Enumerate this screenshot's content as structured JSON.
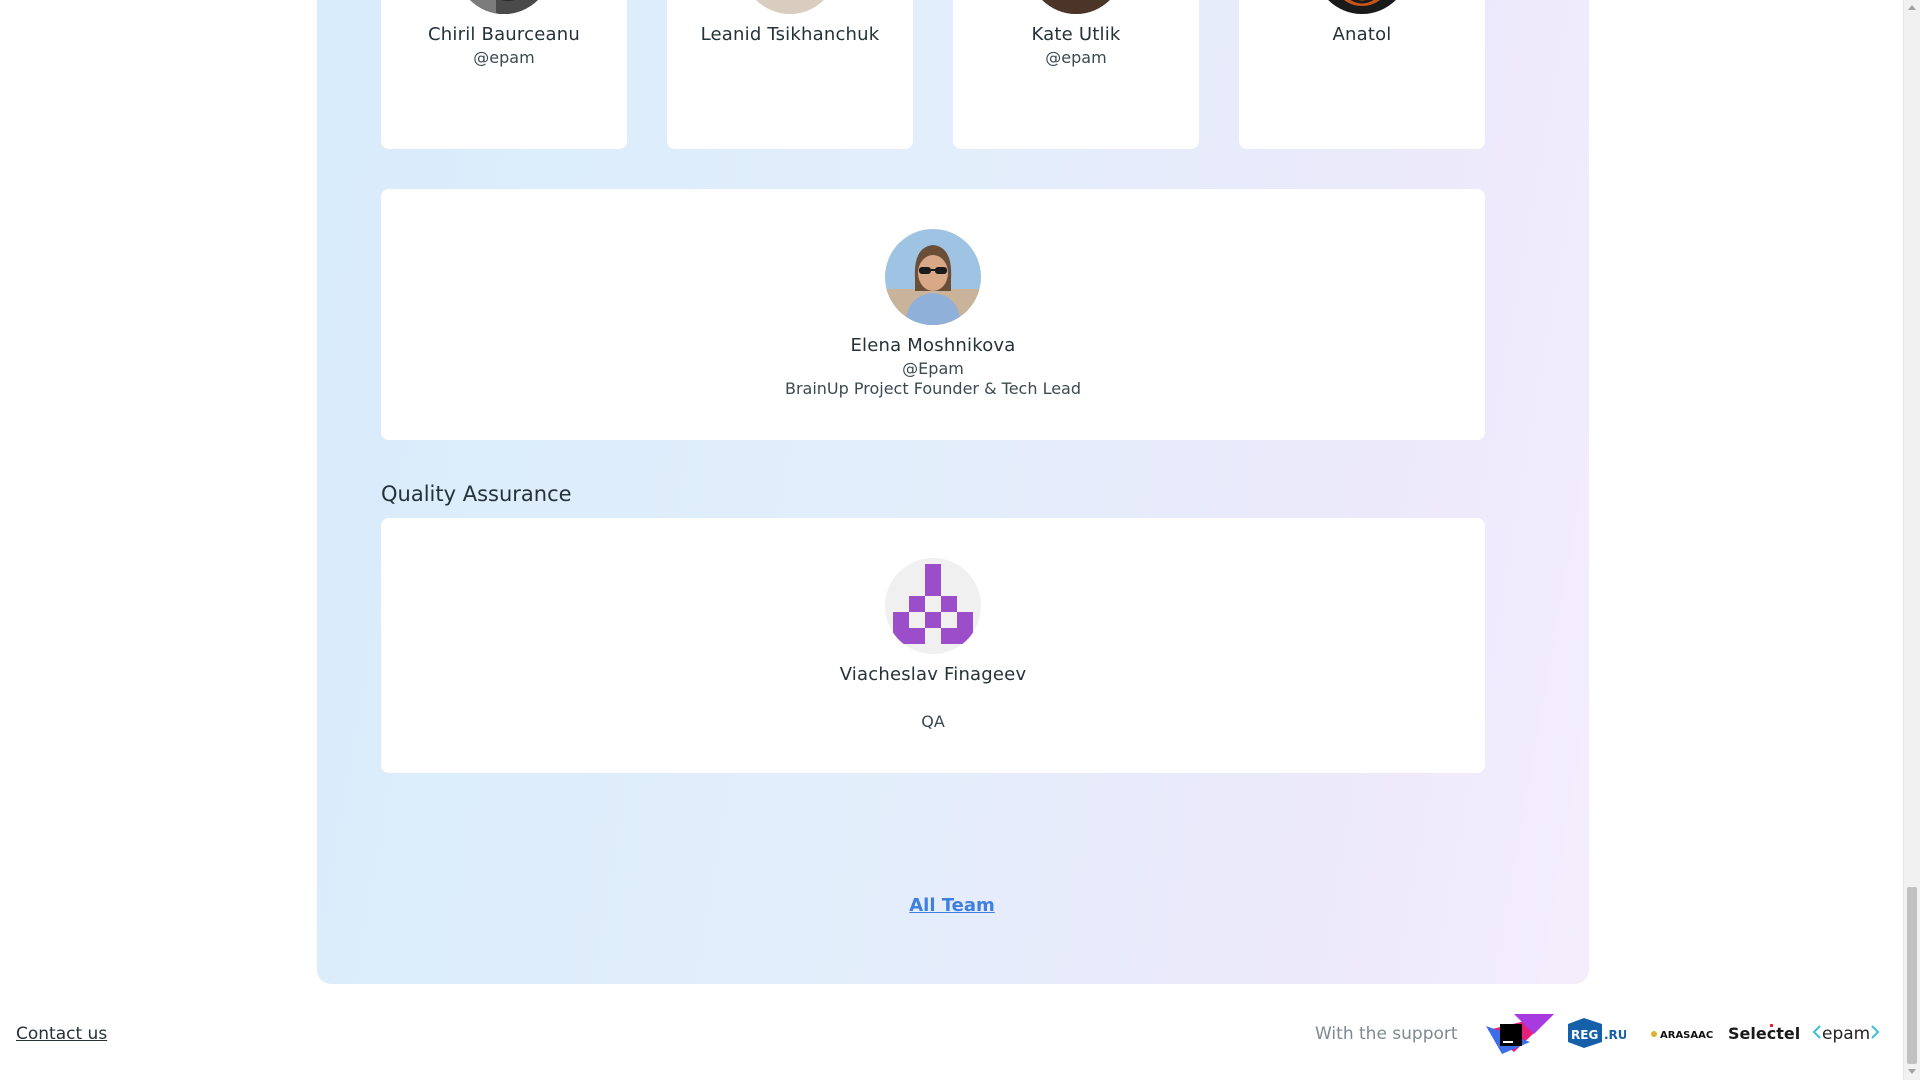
{
  "team_top_row": [
    {
      "name": "Chiril Baurceanu",
      "org": "@epam",
      "avatar_icon": "avatar-bearded-man-icon"
    },
    {
      "name": "Leanid Tsikhanchuk",
      "org": "",
      "avatar_icon": "avatar-opentowork-man-icon"
    },
    {
      "name": "Kate Utlik",
      "org": "@epam",
      "avatar_icon": "avatar-woman-curly-hair-icon"
    },
    {
      "name": "Anatol",
      "org": "",
      "avatar_icon": "avatar-cartoon-glasses-icon"
    }
  ],
  "founder": {
    "name": "Elena Moshnikova",
    "org": "@Epam",
    "role": "BrainUp Project Founder & Tech Lead",
    "avatar_icon": "avatar-woman-sunglasses-icon"
  },
  "qa_section": {
    "title": "Quality Assurance",
    "members": [
      {
        "name": "Viacheslav Finageev",
        "role": "QA",
        "avatar_icon": "avatar-identicon-purple-icon"
      }
    ]
  },
  "all_team_link": "All Team",
  "footer": {
    "contact_label": "Contact us",
    "support_label": "With the support",
    "sponsors": [
      {
        "icon": "jetbrains-logo-icon",
        "text": ""
      },
      {
        "icon": "reg-ru-logo-icon",
        "text": "REG.RU"
      },
      {
        "icon": "arasaac-logo-icon",
        "text": "ARASAAC"
      },
      {
        "icon": "selectel-logo-icon",
        "text": "Selectel"
      },
      {
        "icon": "epam-logo-icon",
        "text": "<epam>"
      }
    ]
  },
  "colors": {
    "panel_gradient_start": "#d8ecfb",
    "panel_gradient_end": "#f4eefc",
    "link_blue": "#3f7fe0",
    "identicon_purple": "#9b4dca"
  }
}
